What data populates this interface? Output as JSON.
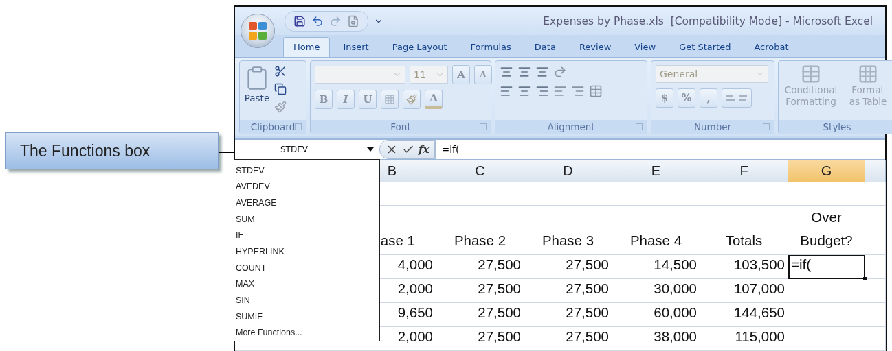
{
  "callout": {
    "text": "The Functions box"
  },
  "window": {
    "title": "Expenses by Phase.xls  [Compatibility Mode] - Microsoft Excel"
  },
  "tabs": [
    {
      "label": "Home",
      "selected": true
    },
    {
      "label": "Insert",
      "selected": false
    },
    {
      "label": "Page Layout",
      "selected": false
    },
    {
      "label": "Formulas",
      "selected": false
    },
    {
      "label": "Data",
      "selected": false
    },
    {
      "label": "Review",
      "selected": false
    },
    {
      "label": "View",
      "selected": false
    },
    {
      "label": "Get Started",
      "selected": false
    },
    {
      "label": "Acrobat",
      "selected": false
    }
  ],
  "ribbon": {
    "clipboard": {
      "label": "Clipboard",
      "paste": "Paste"
    },
    "font": {
      "label": "Font",
      "size": "11",
      "grow": "A",
      "shrink": "A",
      "bold": "B",
      "italic": "I",
      "underline": "U",
      "font_color": "A"
    },
    "alignment": {
      "label": "Alignment"
    },
    "number": {
      "label": "Number",
      "format": "General",
      "currency": "$",
      "percent": "%",
      "comma": ","
    },
    "styles": {
      "label": "Styles",
      "conditional": "Conditional Formatting",
      "format_table": "Format as Table"
    }
  },
  "formula_bar": {
    "name_box": "STDEV",
    "function_button": "fx",
    "formula": "=if("
  },
  "function_menu": {
    "items": [
      "STDEV",
      "AVEDEV",
      "AVERAGE",
      "SUM",
      "IF",
      "HYPERLINK",
      "COUNT",
      "MAX",
      "SIN",
      "SUMIF"
    ],
    "more": "More Functions..."
  },
  "sheet": {
    "columns": [
      {
        "label": "B",
        "selected": false
      },
      {
        "label": "C",
        "selected": false
      },
      {
        "label": "D",
        "selected": false
      },
      {
        "label": "E",
        "selected": false
      },
      {
        "label": "F",
        "selected": false
      },
      {
        "label": "G",
        "selected": true
      }
    ],
    "rows": [
      {
        "kind": "blank"
      },
      {
        "kind": "header",
        "cells": [
          "ase 1",
          "Phase 2",
          "Phase 3",
          "Phase 4",
          "Totals",
          "Over Budget?"
        ]
      },
      {
        "kind": "data",
        "cells": [
          {
            "text": "4,000",
            "selected": false
          },
          {
            "text": "27,500",
            "selected": false
          },
          {
            "text": "27,500",
            "selected": false
          },
          {
            "text": "14,500",
            "selected": false
          },
          {
            "text": "103,500",
            "selected": false
          },
          {
            "text": "=if(",
            "selected": true
          }
        ]
      },
      {
        "kind": "data",
        "cells": [
          {
            "text": "2,000",
            "selected": false
          },
          {
            "text": "27,500",
            "selected": false
          },
          {
            "text": "27,500",
            "selected": false
          },
          {
            "text": "30,000",
            "selected": false
          },
          {
            "text": "107,000",
            "selected": false
          },
          {
            "selected": false
          }
        ]
      },
      {
        "kind": "data",
        "cells": [
          {
            "text": "9,650",
            "selected": false
          },
          {
            "text": "27,500",
            "selected": false
          },
          {
            "text": "27,500",
            "selected": false
          },
          {
            "text": "60,000",
            "selected": false
          },
          {
            "text": "144,650",
            "selected": false
          },
          {
            "selected": false
          }
        ]
      },
      {
        "kind": "data",
        "cells": [
          {
            "text": "2,000",
            "selected": false
          },
          {
            "text": "27,500",
            "selected": false
          },
          {
            "text": "27,500",
            "selected": false
          },
          {
            "text": "38,000",
            "selected": false
          },
          {
            "text": "115,000",
            "selected": false
          },
          {
            "selected": false
          }
        ]
      }
    ]
  }
}
